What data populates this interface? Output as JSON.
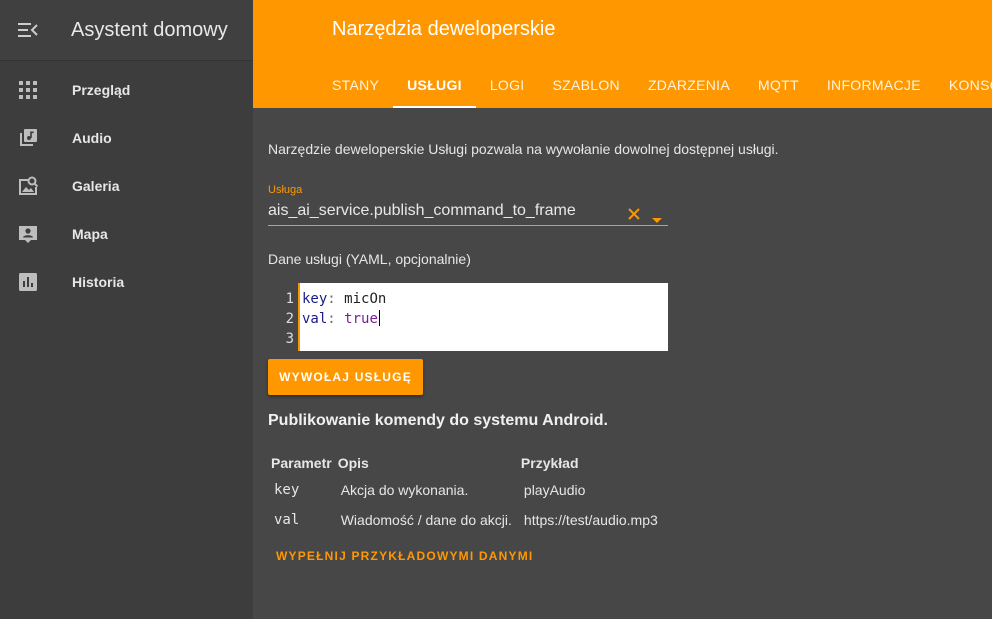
{
  "sidebar": {
    "title": "Asystent domowy",
    "items": [
      {
        "label": "Przegląd",
        "icon": "grid-icon"
      },
      {
        "label": "Audio",
        "icon": "music-library-icon"
      },
      {
        "label": "Galeria",
        "icon": "image-search-icon"
      },
      {
        "label": "Mapa",
        "icon": "account-box-icon"
      },
      {
        "label": "Historia",
        "icon": "chart-box-icon"
      }
    ]
  },
  "header": {
    "title": "Narzędzia deweloperskie",
    "tabs": [
      "Stany",
      "Usługi",
      "Logi",
      "Szablon",
      "Zdarzenia",
      "MQTT",
      "Informacje",
      "Konsola"
    ],
    "active_tab": "Usługi"
  },
  "main": {
    "description": "Narzędzie deweloperskie Usługi pozwala na wywołanie dowolnej dostępnej usługi.",
    "service_label": "Usługa",
    "service_value": "ais_ai_service.publish_command_to_frame",
    "yaml_label": "Dane usługi (YAML, opcjonalnie)",
    "editor": {
      "line_numbers": [
        "1",
        "2",
        "3"
      ],
      "line1_key": "key",
      "line1_value": "micOn",
      "line2_key": "val",
      "line2_value": "true"
    },
    "call_button": "Wywołaj usługę",
    "section_title": "Publikowanie komendy do systemu Android.",
    "table": {
      "headers": [
        "Parametr",
        "Opis",
        "Przykład"
      ],
      "rows": [
        [
          "key",
          "Akcja do wykonania.",
          "playAudio"
        ],
        [
          "val",
          "Wiadomość / dane do akcji.",
          "https://test/audio.mp3"
        ]
      ]
    },
    "fill_button": "Wypełnij przykładowymi danymi"
  },
  "colors": {
    "accent": "#ff9800",
    "sidebar_bg": "#3d3d3d",
    "main_bg": "#474747"
  }
}
